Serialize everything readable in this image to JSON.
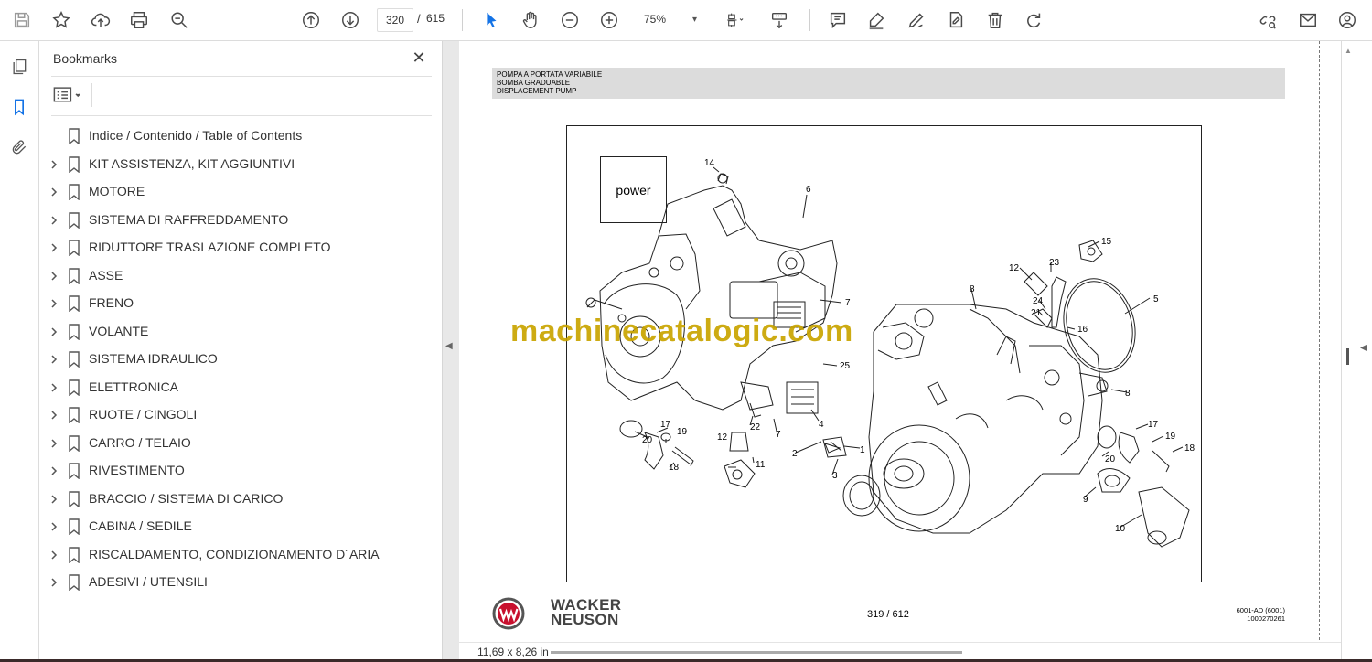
{
  "toolbar": {
    "current_page": "320",
    "page_separator": "/",
    "total_pages": "615",
    "zoom": "75%",
    "zoom_arrow": "▾"
  },
  "bookmarks_panel": {
    "title": "Bookmarks",
    "close_glyph": "✕",
    "items": [
      {
        "label": "Indice / Contenido / Table of Contents",
        "expandable": false
      },
      {
        "label": "KIT ASSISTENZA, KIT AGGIUNTIVI",
        "expandable": true
      },
      {
        "label": "MOTORE",
        "expandable": true
      },
      {
        "label": "SISTEMA DI RAFFREDDAMENTO",
        "expandable": true
      },
      {
        "label": "RIDUTTORE TRASLAZIONE COMPLETO",
        "expandable": true
      },
      {
        "label": "ASSE",
        "expandable": true
      },
      {
        "label": "FRENO",
        "expandable": true
      },
      {
        "label": "VOLANTE",
        "expandable": true
      },
      {
        "label": "SISTEMA IDRAULICO",
        "expandable": true
      },
      {
        "label": "ELETTRONICA",
        "expandable": true
      },
      {
        "label": "RUOTE / CINGOLI",
        "expandable": true
      },
      {
        "label": "CARRO / TELAIO",
        "expandable": true
      },
      {
        "label": "RIVESTIMENTO",
        "expandable": true
      },
      {
        "label": "BRACCIO / SISTEMA DI CARICO",
        "expandable": true
      },
      {
        "label": "CABINA / SEDILE",
        "expandable": true
      },
      {
        "label": "RISCALDAMENTO, CONDIZIONAMENTO D´ARIA",
        "expandable": true
      },
      {
        "label": "ADESIVI / UTENSILI",
        "expandable": true
      }
    ]
  },
  "document": {
    "header_lines": [
      "POMPA A PORTATA VARIABILE",
      "BOMBA GRADUABLE",
      "DISPLACEMENT PUMP"
    ],
    "power_label": "power",
    "watermark": "machinecatalogic.com",
    "callouts": [
      "14",
      "6",
      "7",
      "25",
      "4",
      "22",
      "7",
      "12",
      "11",
      "17",
      "19",
      "18",
      "20",
      "2",
      "1",
      "3",
      "15",
      "23",
      "12",
      "24",
      "21",
      "16",
      "5",
      "8",
      "8",
      "17",
      "19",
      "18",
      "20",
      "9",
      "10"
    ],
    "page_footer": "319 / 612",
    "doc_code": "6001-AD (6001)",
    "doc_number": "1000270261",
    "brand_line1": "WACKER",
    "brand_line2": "NEUSON"
  },
  "status": {
    "page_size": "11,69 x 8,26 in"
  },
  "colors": {
    "watermark": "#c9a400",
    "header_bar": "#dcdcdc"
  }
}
